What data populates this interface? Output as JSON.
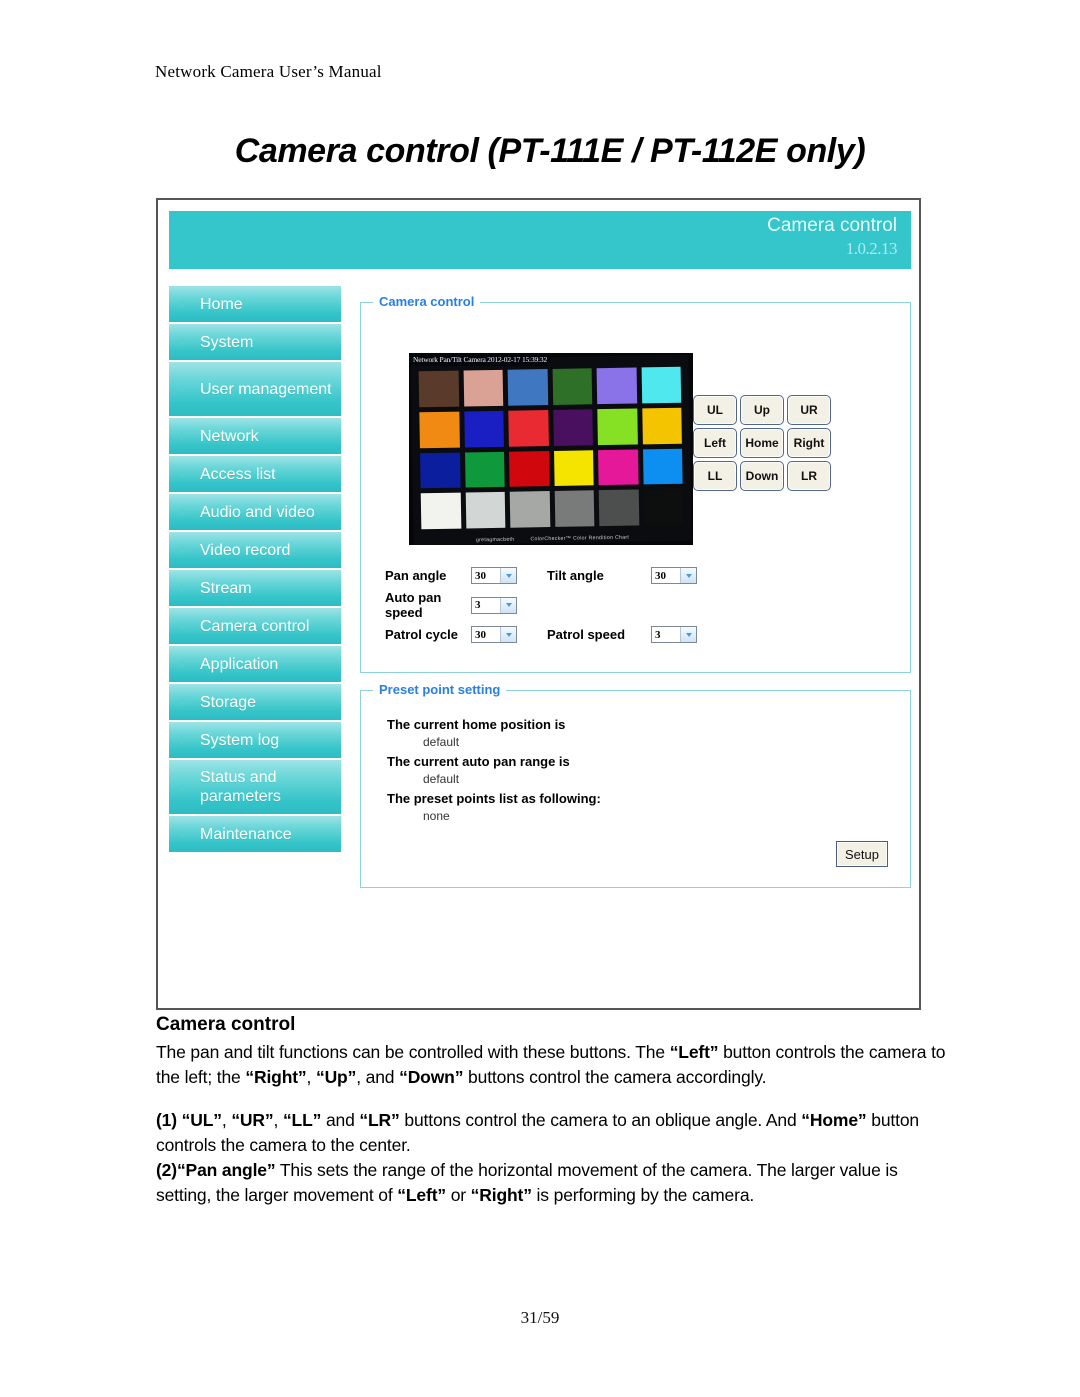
{
  "document": {
    "running_header": "Network Camera User’s Manual",
    "page_title": "Camera control (PT-111E / PT-112E only)",
    "footer": "31/59"
  },
  "app": {
    "header": {
      "title": "Camera control",
      "version": "1.0.2.13",
      "background_color": "#35c6cc"
    },
    "sidebar": {
      "items": [
        {
          "label": "Home"
        },
        {
          "label": "System"
        },
        {
          "label": "User management"
        },
        {
          "label": "Network"
        },
        {
          "label": "Access list"
        },
        {
          "label": "Audio and video"
        },
        {
          "label": "Video record"
        },
        {
          "label": "Stream"
        },
        {
          "label": "Camera control"
        },
        {
          "label": "Application"
        },
        {
          "label": "Storage"
        },
        {
          "label": "System log"
        },
        {
          "label": "Status and parameters"
        },
        {
          "label": "Maintenance"
        }
      ]
    },
    "camera_control_panel": {
      "legend": "Camera control",
      "video": {
        "osd_text": "Network Pan/Tilt Camera 2012-02-17 15:39:32",
        "chart_caption_brand": "gretagmacbeth",
        "chart_caption_name": "ColorChecker™ Color Rendition Chart",
        "swatches": [
          "#5a3a2b",
          "#d9a294",
          "#3f77c0",
          "#2f7028",
          "#8a72e8",
          "#4fe8ee",
          "#f08a12",
          "#1a1fc4",
          "#e92a32",
          "#4a1060",
          "#86e024",
          "#f5c400",
          "#0b1e9e",
          "#0e9a3c",
          "#d1070e",
          "#f4e400",
          "#e41898",
          "#0c8ff0",
          "#f2f2ee",
          "#d2d6d4",
          "#a6a8a6",
          "#787b79",
          "#4c4f4d",
          "#0d0f0e"
        ]
      },
      "dpad_buttons": [
        "UL",
        "Up",
        "UR",
        "Left",
        "Home",
        "Right",
        "LL",
        "Down",
        "LR"
      ],
      "parameters": [
        {
          "label": "Pan angle",
          "value": "30"
        },
        {
          "label": "Tilt angle",
          "value": "30"
        },
        {
          "label": "Auto pan speed",
          "value": "3"
        },
        {
          "label": "Patrol cycle",
          "value": "30"
        },
        {
          "label": "Patrol speed",
          "value": "3"
        }
      ]
    },
    "preset_panel": {
      "legend": "Preset point setting",
      "home_position_label": "The current home position is",
      "home_position_value": "default",
      "auto_pan_range_label": "The current auto pan range is",
      "auto_pan_range_value": "default",
      "preset_points_label": "The preset points list as following:",
      "preset_points_value": "none",
      "setup_button": "Setup"
    }
  },
  "body": {
    "section_title": "Camera control",
    "paragraph1_a": "The pan and tilt functions can be controlled with these buttons. The ",
    "paragraph1_b": "“Left”",
    "paragraph1_c": " button controls the camera to the left; the ",
    "paragraph1_d": "“Right”",
    "paragraph1_e": ", ",
    "paragraph1_f": "“Up”",
    "paragraph1_g": ", and ",
    "paragraph1_h": "“Down”",
    "paragraph1_i": " buttons control the camera accordingly.",
    "item1_num": "(1) ",
    "item1_a": "“UL”",
    "item1_b": ", ",
    "item1_c": "“UR”",
    "item1_d": ", ",
    "item1_e": "“LL”",
    "item1_f": " and ",
    "item1_g": "“LR”",
    "item1_h": " buttons control the camera to an oblique angle. And ",
    "item1_i": "“Home”",
    "item1_j": " button controls the camera to the center.",
    "item2_num": "(2)",
    "item2_a": "“Pan angle”",
    "item2_b": " This sets the range of the horizontal movement of the camera. The larger value is setting, the larger movement of ",
    "item2_c": "“Left”",
    "item2_d": " or ",
    "item2_e": "“Right”",
    "item2_f": " is performing by the camera."
  }
}
